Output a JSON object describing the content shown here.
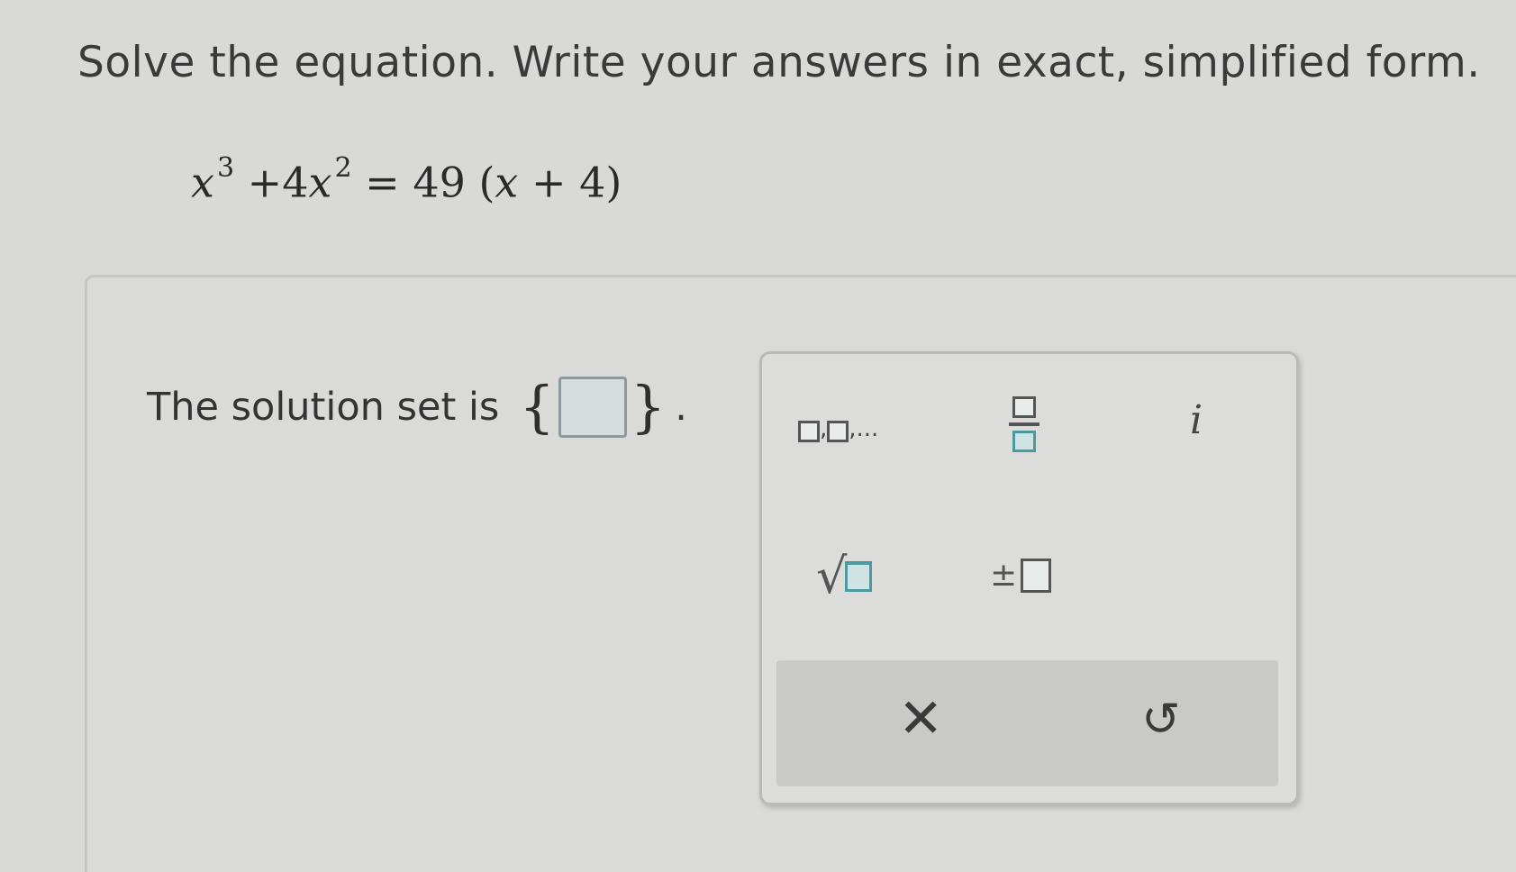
{
  "question": {
    "instructions": "Solve the equation. Write your answers in exact, simplified form.",
    "equation": {
      "lhs_var1": "x",
      "lhs_exp1": "3",
      "lhs_plus": " +4",
      "lhs_var2": "x",
      "lhs_exp2": "2",
      "rhs": " = 49 (",
      "rhs_var": "x",
      "rhs_tail": " + 4)"
    }
  },
  "answer": {
    "prompt": "The solution set is",
    "open_brace": "{",
    "close_brace": "}",
    "value": "",
    "period": "."
  },
  "palette": {
    "list_ellipsis": ",...",
    "list_comma": ",",
    "imaginary": "i",
    "sqrt_symbol": "√",
    "plus_minus": "±",
    "clear_label": "✕",
    "undo_label": "↺"
  }
}
